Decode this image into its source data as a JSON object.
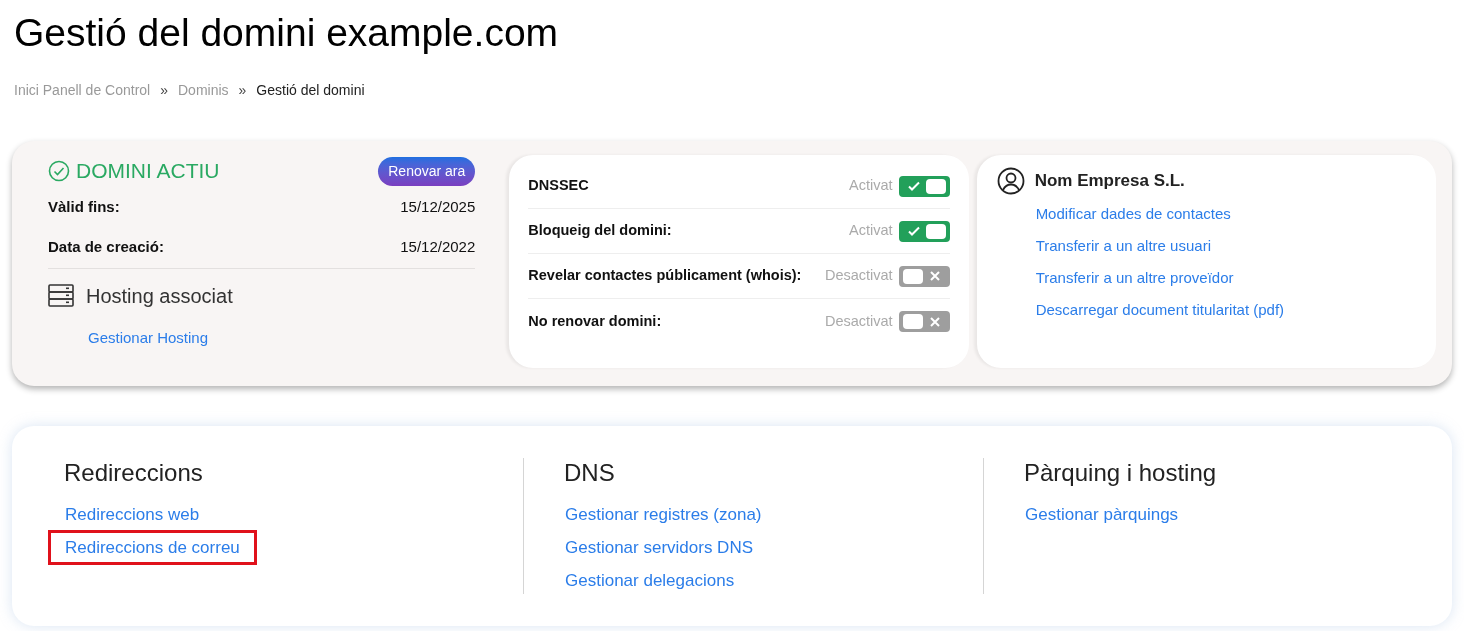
{
  "title": "Gestió del domini example.com",
  "breadcrumb": [
    {
      "label": "Inici Panell de Control",
      "current": false
    },
    {
      "label": "Dominis",
      "current": false
    },
    {
      "label": "Gestió del domini",
      "current": true
    }
  ],
  "breadcrumb_separator": "»",
  "status": {
    "label": "DOMINI ACTIU",
    "active": true,
    "renew_button": "Renovar ara"
  },
  "dates": [
    {
      "label": "Vàlid fins:",
      "value": "15/12/2025"
    },
    {
      "label": "Data de creació:",
      "value": "15/12/2022"
    }
  ],
  "hosting": {
    "title": "Hosting associat",
    "link": "Gestionar Hosting"
  },
  "settings": [
    {
      "label": "DNSSEC",
      "state": "Activat",
      "on": true
    },
    {
      "label": "Bloqueig del domini:",
      "state": "Activat",
      "on": true
    },
    {
      "label": "Revelar contactes públicament (whois):",
      "state": "Desactivat",
      "on": false
    },
    {
      "label": "No renovar domini:",
      "state": "Desactivat",
      "on": false
    }
  ],
  "contact": {
    "name": "Nom Empresa S.L.",
    "links": [
      "Modificar dades de contactes",
      "Transferir a un altre usuari",
      "Transferir a un altre proveïdor",
      "Descarregar document titularitat (pdf)"
    ]
  },
  "sections": [
    {
      "title": "Redireccions",
      "links": [
        {
          "label": "Redireccions web",
          "highlighted": false
        },
        {
          "label": "Redireccions de correu",
          "highlighted": true
        }
      ]
    },
    {
      "title": "DNS",
      "links": [
        {
          "label": "Gestionar registres (zona)",
          "highlighted": false
        },
        {
          "label": "Gestionar servidors DNS",
          "highlighted": false
        },
        {
          "label": "Gestionar delegacions",
          "highlighted": false
        }
      ]
    },
    {
      "title": "Pàrquing i hosting",
      "links": [
        {
          "label": "Gestionar pàrquings",
          "highlighted": false
        }
      ]
    }
  ]
}
